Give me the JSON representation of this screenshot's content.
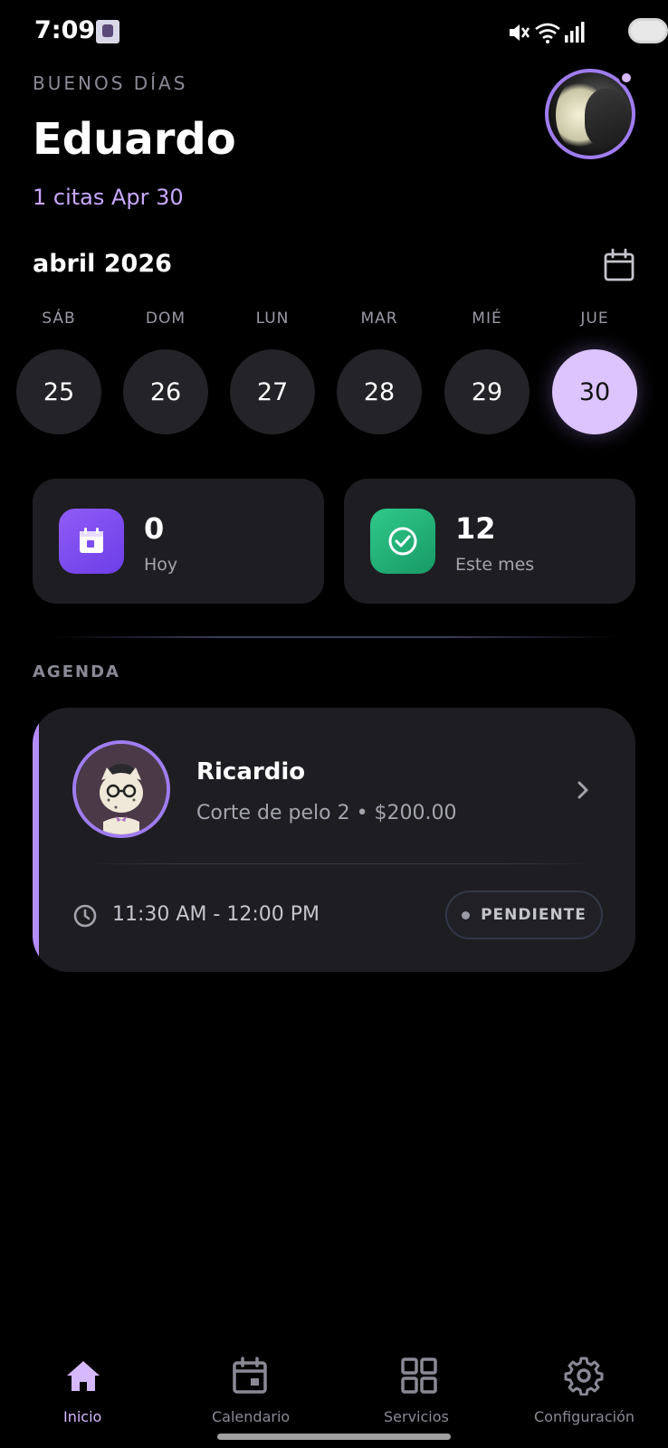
{
  "status_bar": {
    "time": "7:09",
    "icons": [
      "mute-icon",
      "wifi-icon",
      "signal-icon",
      "battery-icon"
    ]
  },
  "header": {
    "greeting": "BUENOS DÍAS",
    "user_name": "Eduardo",
    "appointments_summary": "1 citas Apr 30"
  },
  "calendar": {
    "month_label": "abril 2026",
    "days": [
      {
        "label": "SÁB",
        "number": "25",
        "selected": false
      },
      {
        "label": "DOM",
        "number": "26",
        "selected": false
      },
      {
        "label": "LUN",
        "number": "27",
        "selected": false
      },
      {
        "label": "MAR",
        "number": "28",
        "selected": false
      },
      {
        "label": "MIÉ",
        "number": "29",
        "selected": false
      },
      {
        "label": "JUE",
        "number": "30",
        "selected": true
      }
    ]
  },
  "stats": {
    "today": {
      "value": "0",
      "label": "Hoy",
      "icon": "calendar-icon",
      "color": "#7c4df0"
    },
    "month": {
      "value": "12",
      "label": "Este mes",
      "icon": "check-circle-icon",
      "color": "#22b078"
    }
  },
  "agenda": {
    "section_title": "AGENDA",
    "appointments": [
      {
        "client_name": "Ricardio",
        "service": "Corte de pelo 2 • $200.00",
        "time": "11:30 AM - 12:00 PM",
        "status": "PENDIENTE",
        "accent_color": "#b48cff"
      }
    ]
  },
  "nav": {
    "items": [
      {
        "label": "Inicio",
        "icon": "home-icon",
        "active": true
      },
      {
        "label": "Calendario",
        "icon": "calendar-icon",
        "active": false
      },
      {
        "label": "Servicios",
        "icon": "grid-icon",
        "active": false
      },
      {
        "label": "Configuración",
        "icon": "gear-icon",
        "active": false
      }
    ]
  },
  "colors": {
    "accent": "#d6b8ff",
    "background": "#000000",
    "card": "#1e1e22"
  }
}
